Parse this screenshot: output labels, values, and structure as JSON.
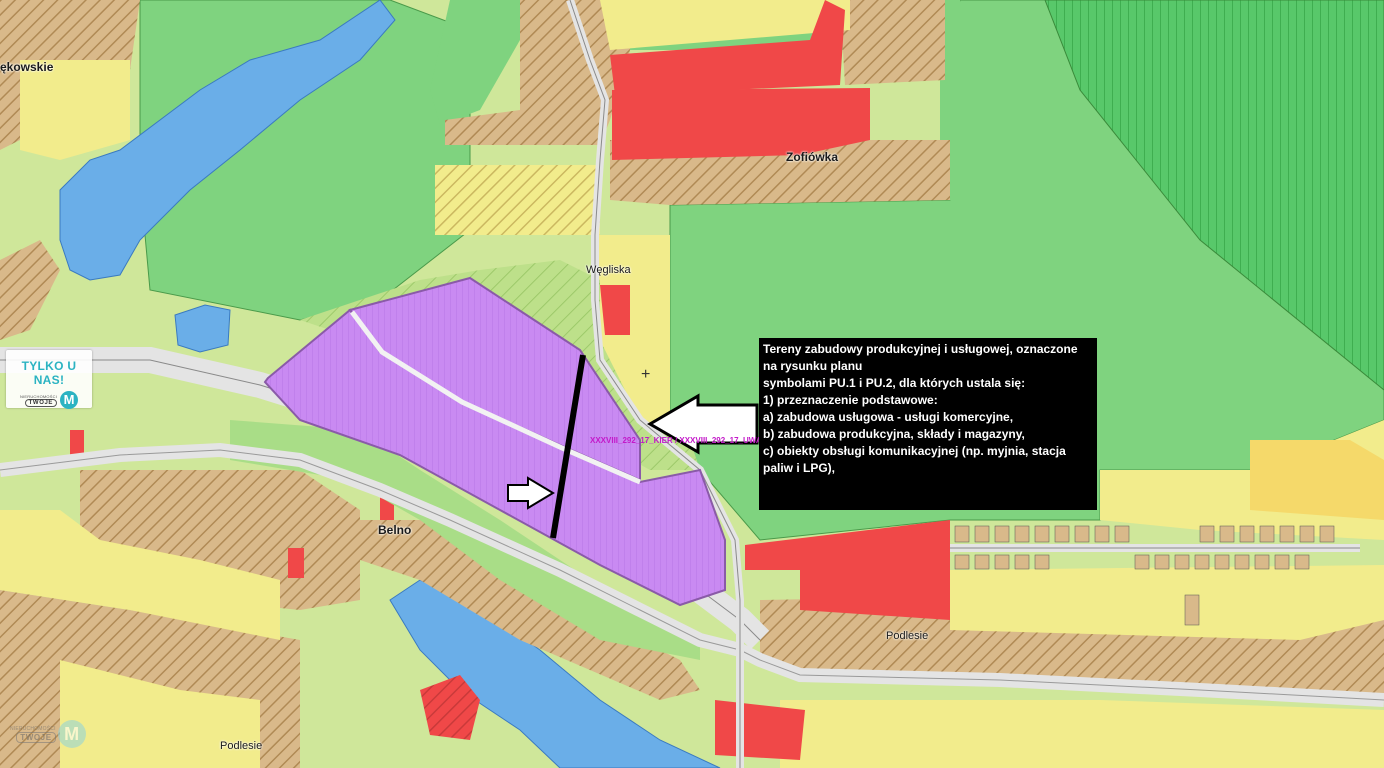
{
  "map": {
    "labels": {
      "top_left": "ękowskie",
      "zofiowka": "Zofiówka",
      "wegliska": "Węgliska",
      "belno": "Belno",
      "podlesie_right": "Podlesie",
      "podlesie_bottom": "Podlesie"
    },
    "plan_code": "XXXVIII_292_17_KIER / XXXVIII_292_17_UWAR",
    "colors": {
      "background": "#cfe79a",
      "forest": "#7fd37f",
      "forest_dark": "#58c86a",
      "water": "#6aaee8",
      "residential_yellow": "#f2ec8c",
      "agricultural_tan": "#d9b98a",
      "service_red": "#f04848",
      "industrial_purple": "#c98af2",
      "road": "#e4e4e4",
      "info_box": "#000000",
      "info_text": "#ffffff",
      "plan_code": "#c319c9",
      "brand": "#2bb3c2"
    }
  },
  "badge": {
    "text": "TYLKO U NAS!",
    "agency_small": "NIERUCHOMOŚCI",
    "agency_word": "TWOJE",
    "logo_letter": "M"
  },
  "watermark": {
    "agency_small": "NIERUCHOMOŚCI",
    "agency_word": "TWOJE",
    "logo_letter": "M"
  },
  "info_box": {
    "lines": [
      "Tereny zabudowy produkcyjnej i usługowej, oznaczone na rysunku planu",
      "symbolami PU.1 i PU.2, dla których ustala się:",
      "1) przeznaczenie podstawowe:",
      "a) zabudowa usługowa - usługi komercyjne,",
      "b) zabudowa produkcyjna, składy i magazyny,",
      "c) obiekty obsługi komunikacyjnej (np. myjnia, stacja paliw i LPG),"
    ]
  }
}
